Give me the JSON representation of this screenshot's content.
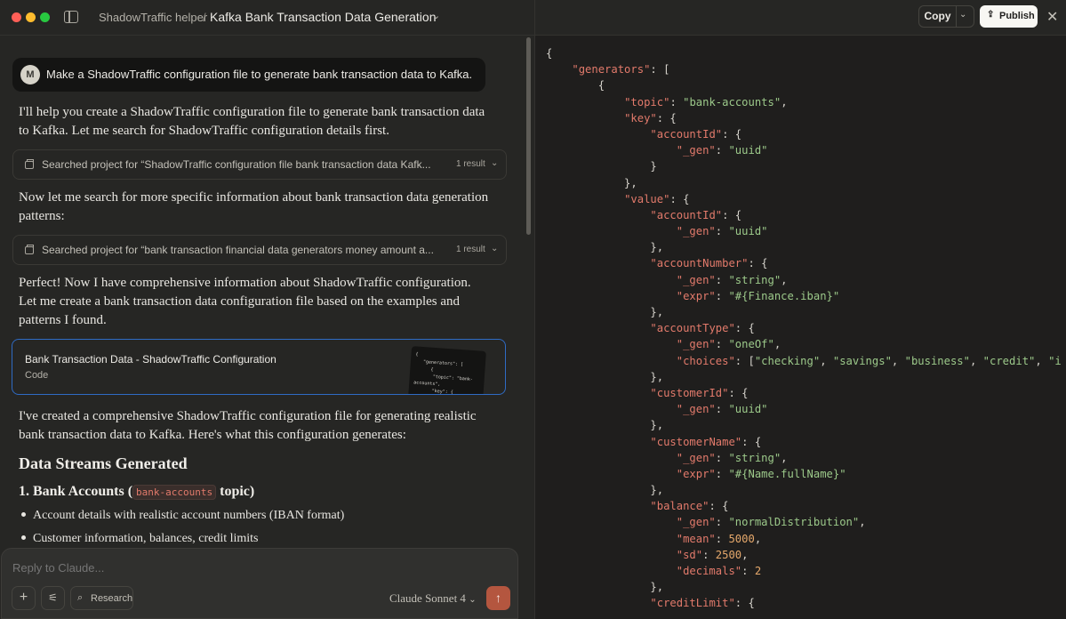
{
  "window": {
    "breadcrumb_project": "ShadowTraffic helper",
    "breadcrumb_sep": "/",
    "chat_title": "Kafka Bank Transaction Data Generation"
  },
  "chat": {
    "user_initial": "M",
    "user_message": "Make a ShadowTraffic configuration file to generate bank transaction data to Kafka.",
    "para1": "I'll help you create a ShadowTraffic configuration file to generate bank transaction data to Kafka. Let me search for ShadowTraffic configuration details first.",
    "search1": {
      "text": "Searched project for “ShadowTraffic configuration file bank transaction data Kafk...",
      "count": "1 result"
    },
    "para2": "Now let me search for more specific information about bank transaction data generation patterns:",
    "search2": {
      "text": "Searched project for “bank transaction financial data generators money amount a...",
      "count": "1 result"
    },
    "para3": "Perfect! Now I have comprehensive information about ShadowTraffic configuration. Let me create a bank transaction data configuration file based on the examples and patterns I found.",
    "artifact": {
      "title": "Bank Transaction Data - ShadowTraffic Configuration",
      "type": "Code",
      "thumb": "{\n   \"generators\": [\n      {\n       \"topic\": \"bank-\naccounts\",\n       \"key\": {\n\"accountId\": {\n\"_gen\":          \"_gen\":"
    },
    "para4": "I've created a comprehensive ShadowTraffic configuration file for generating realistic bank transaction data to Kafka. Here's what this configuration generates:",
    "heading": "Data Streams Generated",
    "subheading_prefix": "1. Bank Accounts (",
    "subheading_code": "bank-accounts",
    "subheading_suffix": "topic)",
    "bullets": [
      "Account details with realistic account numbers (IBAN format)",
      "Customer information, balances, credit limits"
    ]
  },
  "composer": {
    "placeholder": "Reply to Claude...",
    "research_label": "Research",
    "model": "Claude Sonnet 4"
  },
  "artifact_header": {
    "copy_label": "Copy",
    "publish_label": "Publish"
  },
  "code_lines": [
    [
      [
        "p",
        "{"
      ]
    ],
    [
      [
        "p",
        "    "
      ],
      [
        "k",
        "\"generators\""
      ],
      [
        "p",
        ": ["
      ]
    ],
    [
      [
        "p",
        "        {"
      ]
    ],
    [
      [
        "p",
        "            "
      ],
      [
        "k",
        "\"topic\""
      ],
      [
        "p",
        ": "
      ],
      [
        "s",
        "\"bank-accounts\""
      ],
      [
        "p",
        ","
      ]
    ],
    [
      [
        "p",
        "            "
      ],
      [
        "k",
        "\"key\""
      ],
      [
        "p",
        ": {"
      ]
    ],
    [
      [
        "p",
        "                "
      ],
      [
        "k",
        "\"accountId\""
      ],
      [
        "p",
        ": {"
      ]
    ],
    [
      [
        "p",
        "                    "
      ],
      [
        "k",
        "\"_gen\""
      ],
      [
        "p",
        ": "
      ],
      [
        "s",
        "\"uuid\""
      ]
    ],
    [
      [
        "p",
        "                }"
      ]
    ],
    [
      [
        "p",
        "            },"
      ]
    ],
    [
      [
        "p",
        "            "
      ],
      [
        "k",
        "\"value\""
      ],
      [
        "p",
        ": {"
      ]
    ],
    [
      [
        "p",
        "                "
      ],
      [
        "k",
        "\"accountId\""
      ],
      [
        "p",
        ": {"
      ]
    ],
    [
      [
        "p",
        "                    "
      ],
      [
        "k",
        "\"_gen\""
      ],
      [
        "p",
        ": "
      ],
      [
        "s",
        "\"uuid\""
      ]
    ],
    [
      [
        "p",
        "                },"
      ]
    ],
    [
      [
        "p",
        "                "
      ],
      [
        "k",
        "\"accountNumber\""
      ],
      [
        "p",
        ": {"
      ]
    ],
    [
      [
        "p",
        "                    "
      ],
      [
        "k",
        "\"_gen\""
      ],
      [
        "p",
        ": "
      ],
      [
        "s",
        "\"string\""
      ],
      [
        "p",
        ","
      ]
    ],
    [
      [
        "p",
        "                    "
      ],
      [
        "k",
        "\"expr\""
      ],
      [
        "p",
        ": "
      ],
      [
        "s",
        "\"#{Finance.iban}\""
      ]
    ],
    [
      [
        "p",
        "                },"
      ]
    ],
    [
      [
        "p",
        "                "
      ],
      [
        "k",
        "\"accountType\""
      ],
      [
        "p",
        ": {"
      ]
    ],
    [
      [
        "p",
        "                    "
      ],
      [
        "k",
        "\"_gen\""
      ],
      [
        "p",
        ": "
      ],
      [
        "s",
        "\"oneOf\""
      ],
      [
        "p",
        ","
      ]
    ],
    [
      [
        "p",
        "                    "
      ],
      [
        "k",
        "\"choices\""
      ],
      [
        "p",
        ": ["
      ],
      [
        "s",
        "\"checking\""
      ],
      [
        "p",
        ", "
      ],
      [
        "s",
        "\"savings\""
      ],
      [
        "p",
        ", "
      ],
      [
        "s",
        "\"business\""
      ],
      [
        "p",
        ", "
      ],
      [
        "s",
        "\"credit\""
      ],
      [
        "p",
        ", "
      ],
      [
        "s",
        "\"investment\""
      ]
    ],
    [
      [
        "p",
        "                },"
      ]
    ],
    [
      [
        "p",
        "                "
      ],
      [
        "k",
        "\"customerId\""
      ],
      [
        "p",
        ": {"
      ]
    ],
    [
      [
        "p",
        "                    "
      ],
      [
        "k",
        "\"_gen\""
      ],
      [
        "p",
        ": "
      ],
      [
        "s",
        "\"uuid\""
      ]
    ],
    [
      [
        "p",
        "                },"
      ]
    ],
    [
      [
        "p",
        "                "
      ],
      [
        "k",
        "\"customerName\""
      ],
      [
        "p",
        ": {"
      ]
    ],
    [
      [
        "p",
        "                    "
      ],
      [
        "k",
        "\"_gen\""
      ],
      [
        "p",
        ": "
      ],
      [
        "s",
        "\"string\""
      ],
      [
        "p",
        ","
      ]
    ],
    [
      [
        "p",
        "                    "
      ],
      [
        "k",
        "\"expr\""
      ],
      [
        "p",
        ": "
      ],
      [
        "s",
        "\"#{Name.fullName}\""
      ]
    ],
    [
      [
        "p",
        "                },"
      ]
    ],
    [
      [
        "p",
        "                "
      ],
      [
        "k",
        "\"balance\""
      ],
      [
        "p",
        ": {"
      ]
    ],
    [
      [
        "p",
        "                    "
      ],
      [
        "k",
        "\"_gen\""
      ],
      [
        "p",
        ": "
      ],
      [
        "s",
        "\"normalDistribution\""
      ],
      [
        "p",
        ","
      ]
    ],
    [
      [
        "p",
        "                    "
      ],
      [
        "k",
        "\"mean\""
      ],
      [
        "p",
        ": "
      ],
      [
        "n",
        "5000"
      ],
      [
        "p",
        ","
      ]
    ],
    [
      [
        "p",
        "                    "
      ],
      [
        "k",
        "\"sd\""
      ],
      [
        "p",
        ": "
      ],
      [
        "n",
        "2500"
      ],
      [
        "p",
        ","
      ]
    ],
    [
      [
        "p",
        "                    "
      ],
      [
        "k",
        "\"decimals\""
      ],
      [
        "p",
        ": "
      ],
      [
        "n",
        "2"
      ]
    ],
    [
      [
        "p",
        "                },"
      ]
    ],
    [
      [
        "p",
        "                "
      ],
      [
        "k",
        "\"creditLimit\""
      ],
      [
        "p",
        ": {"
      ]
    ]
  ]
}
